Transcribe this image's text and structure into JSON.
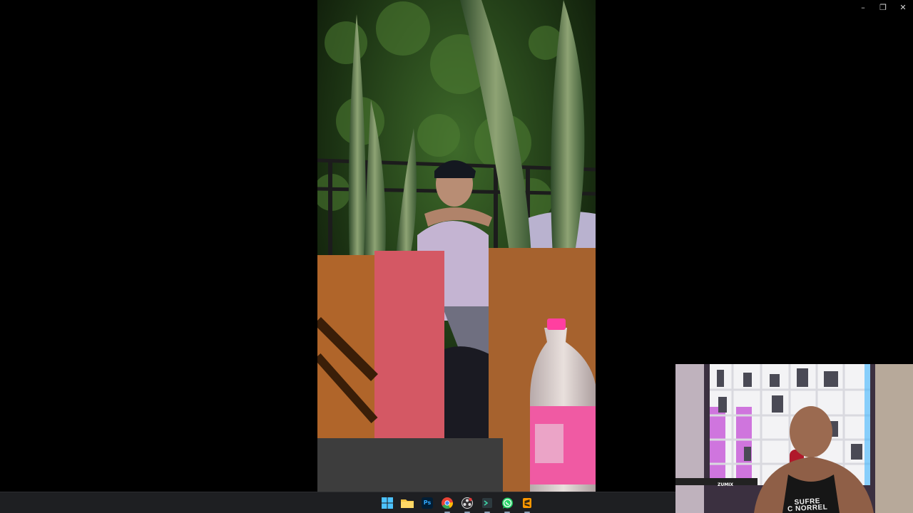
{
  "window_controls": {
    "minimize_glyph": "–",
    "restore_glyph": "❐",
    "close_glyph": "✕"
  },
  "video": {
    "description_icon": "video-frame"
  },
  "webcam": {
    "shirt_text": "SUFRE\nC NORREL",
    "logo_text": "ZUMIX"
  },
  "taskbar": {
    "apps": [
      {
        "name": "windows-start",
        "icon": "windows-logo-icon"
      },
      {
        "name": "file-explorer",
        "icon": "folder-icon"
      },
      {
        "name": "photoshop",
        "icon": "photoshop-icon",
        "label": "Ps"
      },
      {
        "name": "chrome",
        "icon": "chrome-icon"
      },
      {
        "name": "obs",
        "icon": "obs-icon"
      },
      {
        "name": "terminal-app",
        "icon": "terminal-icon"
      },
      {
        "name": "whatsapp",
        "icon": "whatsapp-icon"
      },
      {
        "name": "sublime-text",
        "icon": "sublime-icon"
      }
    ]
  },
  "colors": {
    "taskbar_bg": "#1e1f22",
    "background": "#000000",
    "windows_blue": "#4cc2ff",
    "whatsapp_green": "#25d366"
  }
}
